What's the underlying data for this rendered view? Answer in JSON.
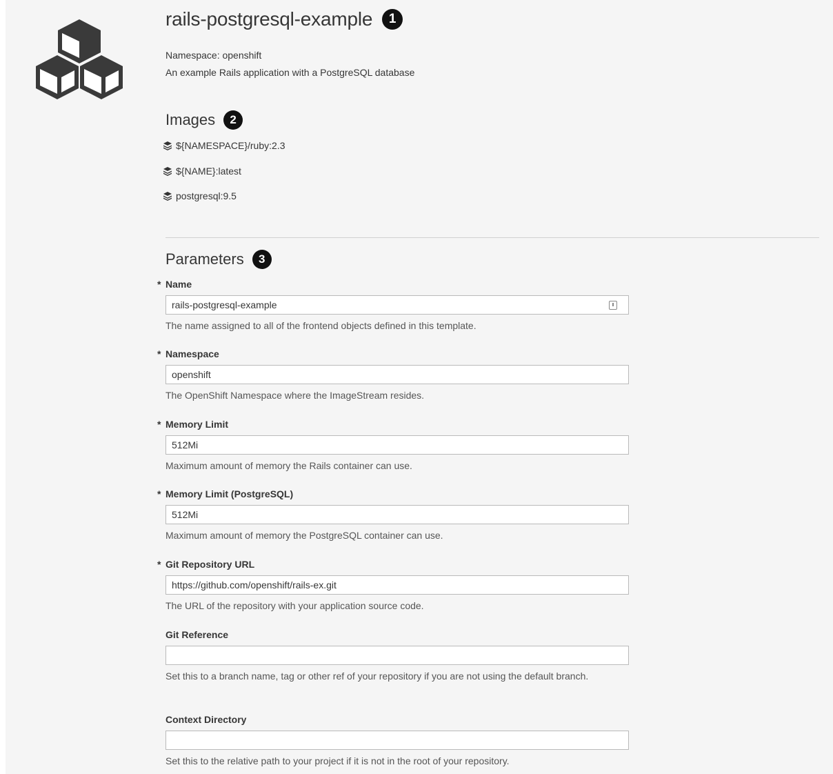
{
  "template": {
    "title": "rails-postgresql-example",
    "callout_1": "1",
    "namespace_line": "Namespace: openshift",
    "description": "An example Rails application with a PostgreSQL database"
  },
  "images": {
    "heading": "Images",
    "callout_2": "2",
    "items": [
      {
        "icon": "layers-icon",
        "label": "${NAMESPACE}/ruby:2.3"
      },
      {
        "icon": "layers-icon",
        "label": "${NAME}:latest"
      },
      {
        "icon": "layers-icon",
        "label": "postgresql:9.5"
      }
    ]
  },
  "parameters": {
    "heading": "Parameters",
    "callout_3": "3",
    "required_mark": "*",
    "fields": [
      {
        "label": "Name",
        "required": true,
        "value": "rails-postgresql-example",
        "help": "The name assigned to all of the frontend objects defined in this template."
      },
      {
        "label": "Namespace",
        "required": true,
        "value": "openshift",
        "help": "The OpenShift Namespace where the ImageStream resides."
      },
      {
        "label": "Memory Limit",
        "required": true,
        "value": "512Mi",
        "help": "Maximum amount of memory the Rails container can use."
      },
      {
        "label": "Memory Limit (PostgreSQL)",
        "required": true,
        "value": "512Mi",
        "help": "Maximum amount of memory the PostgreSQL container can use."
      },
      {
        "label": "Git Repository URL",
        "required": true,
        "value": "https://github.com/openshift/rails-ex.git",
        "help": "The URL of the repository with your application source code."
      },
      {
        "label": "Git Reference",
        "required": false,
        "value": "",
        "help": "Set this to a branch name, tag or other ref of your repository if you are not using the default branch."
      },
      {
        "label": "Context Directory",
        "required": false,
        "value": "",
        "help": "Set this to the relative path to your project if it is not in the root of your repository."
      }
    ]
  }
}
